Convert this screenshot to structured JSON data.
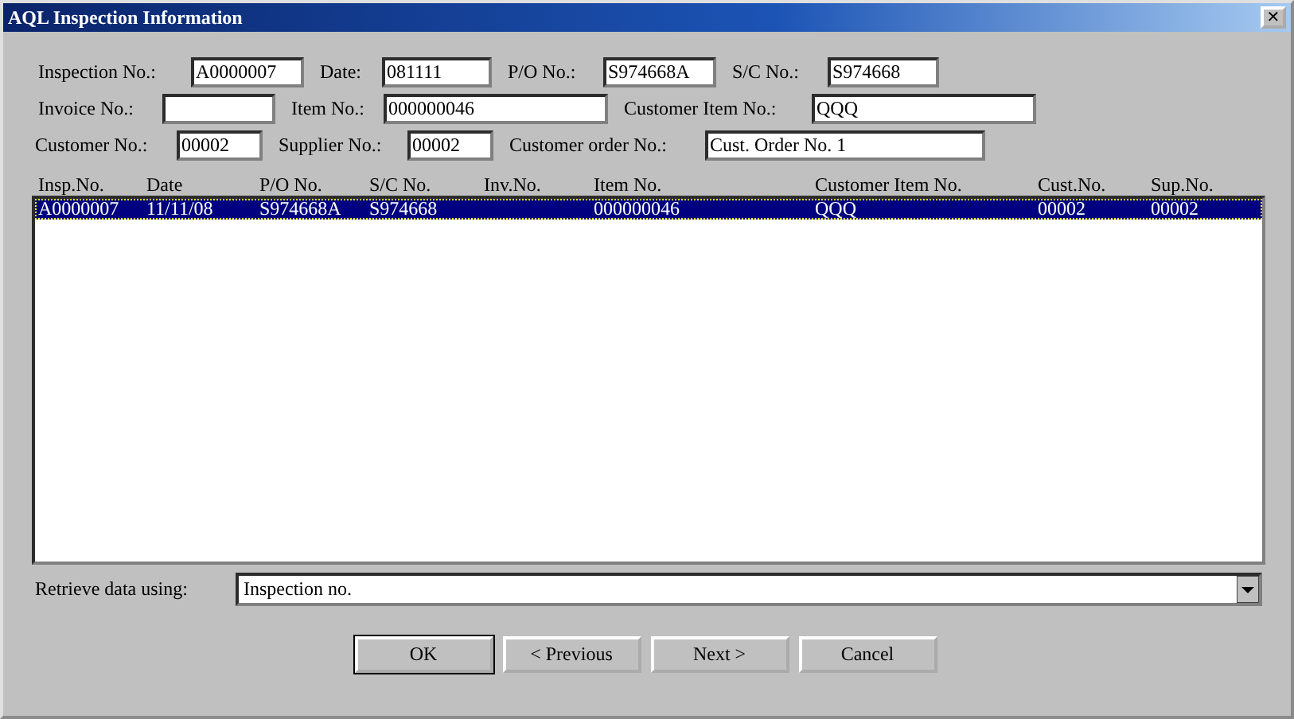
{
  "window": {
    "title": "AQL Inspection Information",
    "close": "✕"
  },
  "field_rows": [
    [
      {
        "label": "Inspection No.:",
        "value": "A0000007"
      },
      {
        "label": "Date:",
        "value": "081111"
      },
      {
        "label": "P/O No.:",
        "value": "S974668A"
      },
      {
        "label": "S/C No.:",
        "value": "S974668"
      }
    ],
    [
      {
        "label": "Invoice No.:"
      },
      {
        "label": "Item No.:",
        "value": "000000046"
      },
      {
        "label": "Customer Item No.:",
        "value": "QQQ"
      }
    ],
    [
      {
        "label": "Customer No.:",
        "value": "00002"
      },
      {
        "label": "Supplier No.:",
        "value": "00002"
      },
      {
        "label": "Customer order No.:",
        "value": "Cust. Order No. 1"
      }
    ]
  ],
  "table": {
    "columns": [
      "Insp.No.",
      "Date",
      "P/O No.",
      "S/C No.",
      "Inv.No.",
      "Item No.",
      "Customer Item No.",
      "Cust.No.",
      "Sup.No."
    ],
    "rows": [
      {
        "selected": true,
        "cells": [
          "A0000007",
          "11/11/08",
          "S974668A",
          "S974668",
          "",
          "000000046",
          "QQQ",
          "00002",
          "00002"
        ]
      }
    ]
  },
  "retrieve": {
    "label": "Retrieve data using:",
    "value": "Inspection no."
  },
  "buttons": [
    {
      "label": "OK",
      "default": true
    },
    {
      "label": "< Previous",
      "default": false
    },
    {
      "label": "Next >",
      "default": false
    },
    {
      "label": "Cancel",
      "default": false
    }
  ]
}
